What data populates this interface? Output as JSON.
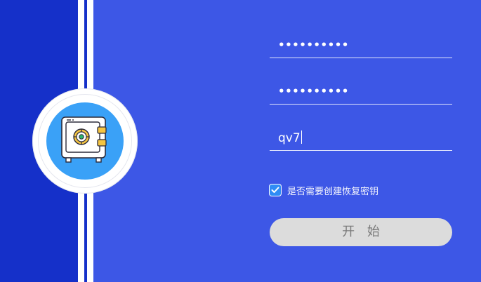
{
  "form": {
    "password": {
      "value": "••••••••••"
    },
    "confirm_password": {
      "value": "••••••••••"
    },
    "hint": {
      "value": "qv7"
    },
    "recovery_key_checkbox": {
      "label": "是否需要创建恢复密钥",
      "checked": true
    },
    "start_button": {
      "label": "开 始"
    }
  },
  "icons": {
    "badge": "safe-icon",
    "checkbox": "check-icon"
  },
  "colors": {
    "background": "#3d57e6",
    "left_panel": "#1530c9",
    "badge_fill": "#3aa1f7",
    "checkbox": "#2f8cf5",
    "button": "#dcdcdc"
  }
}
